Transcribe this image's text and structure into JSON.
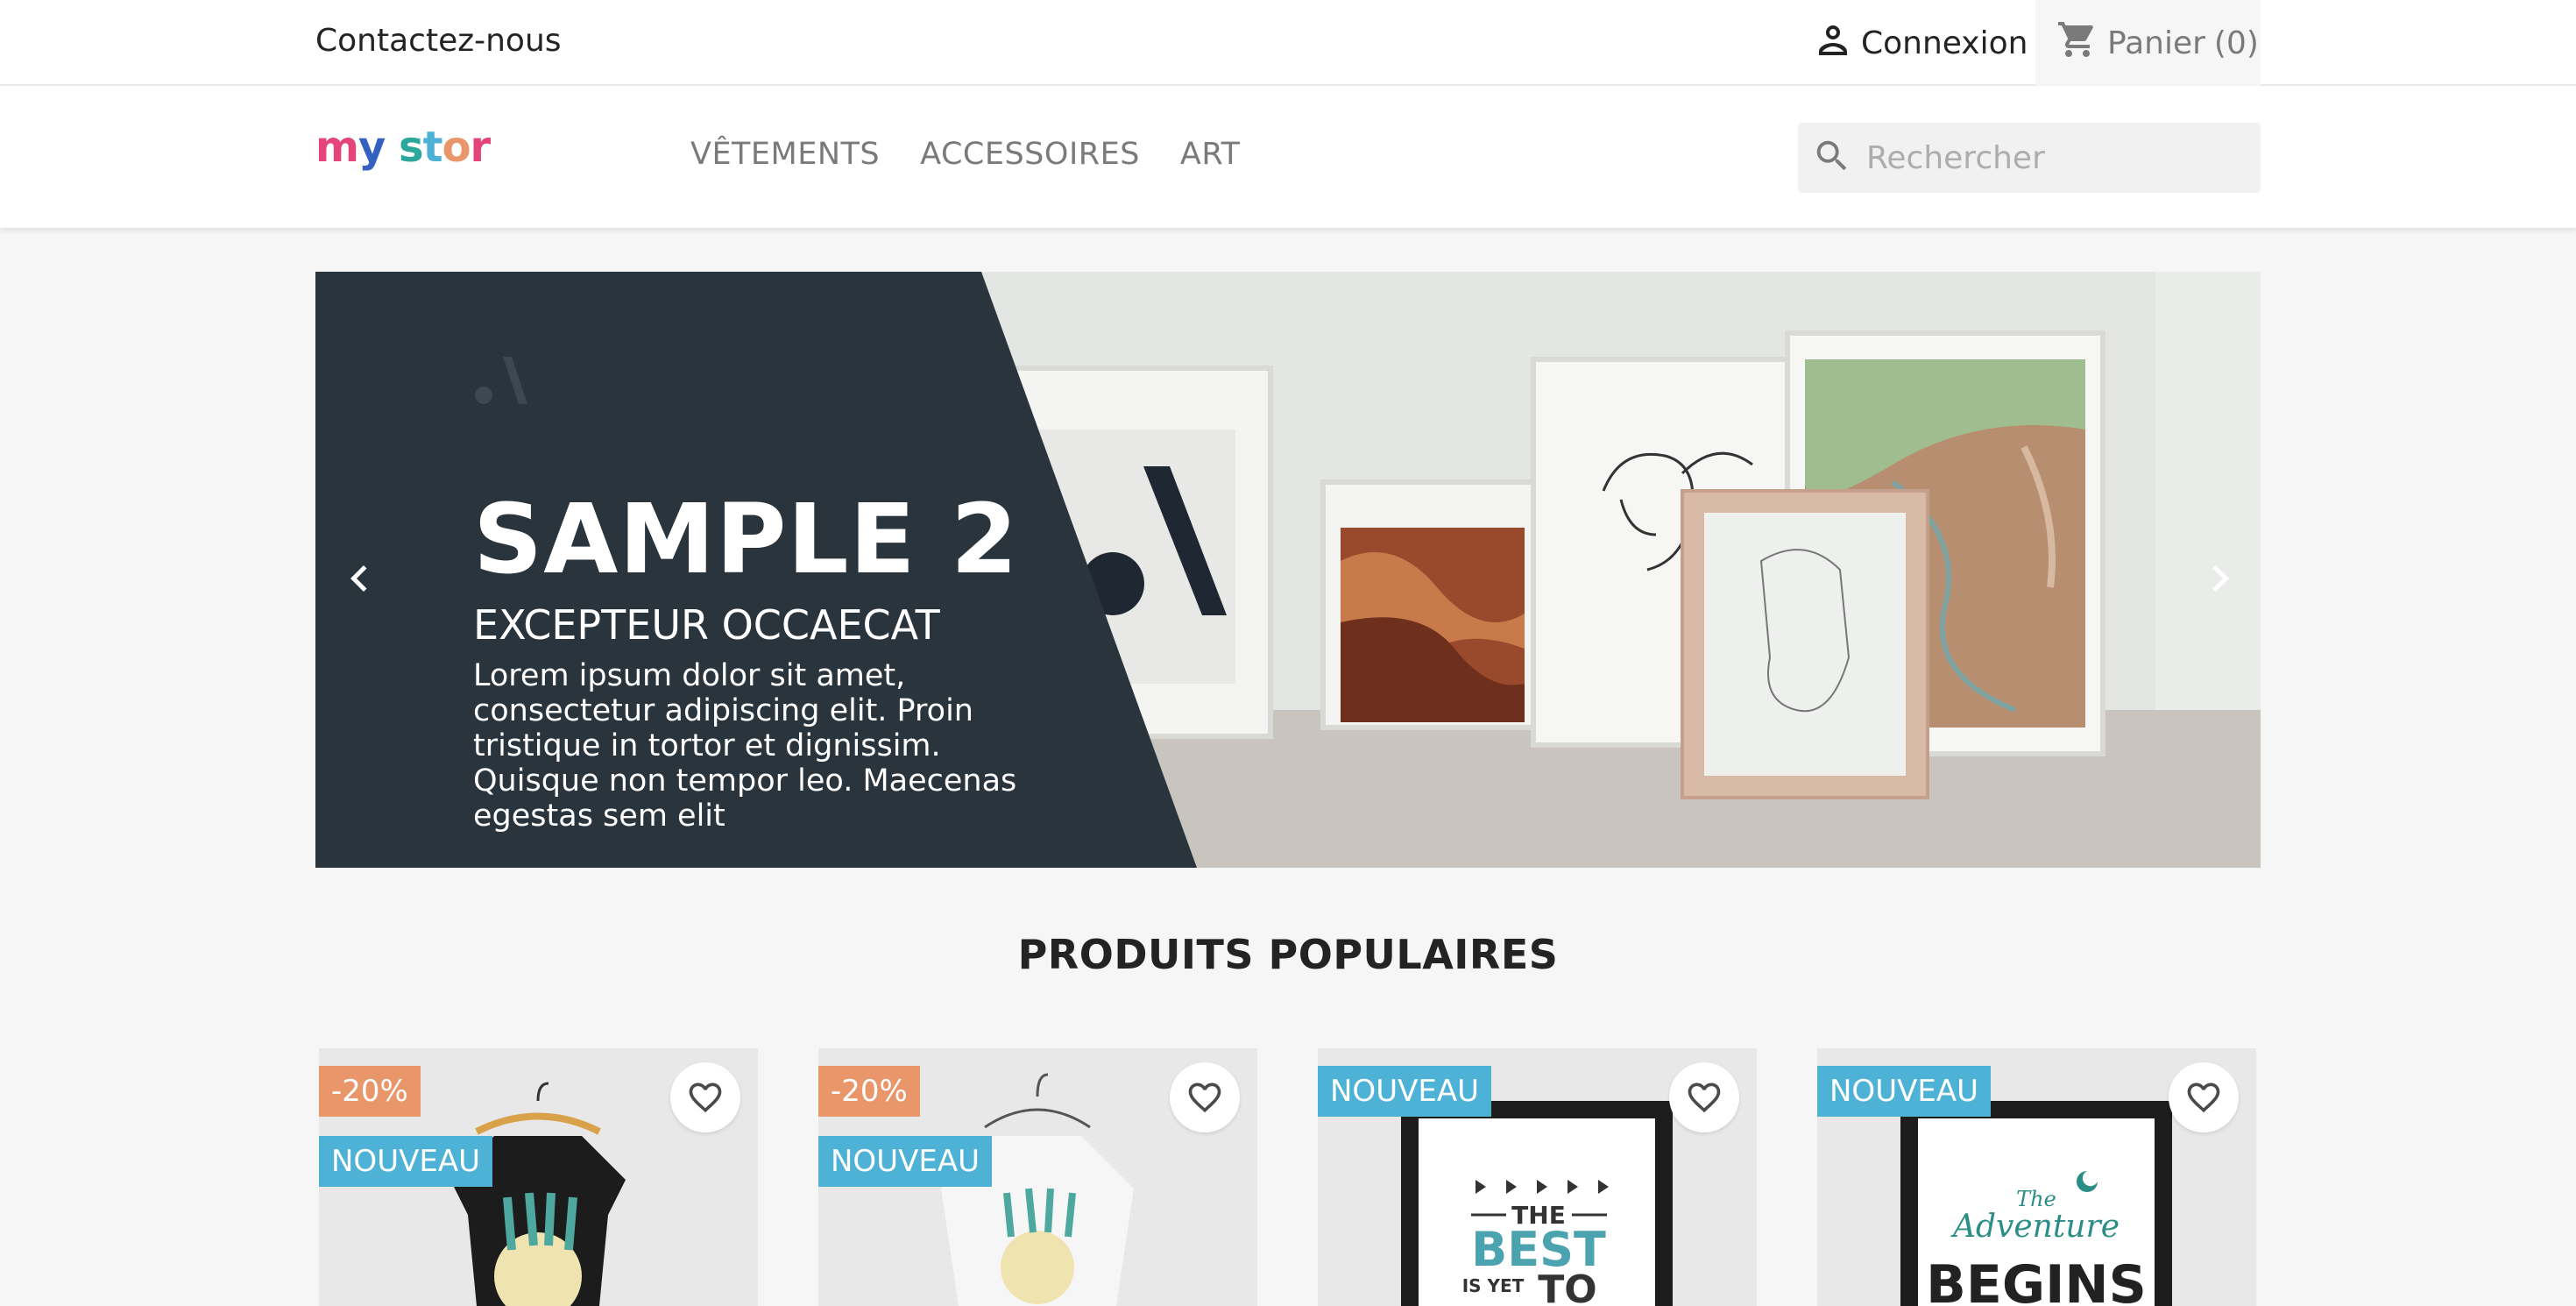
{
  "topbar": {
    "contact_label": "Contactez-nous",
    "signin_label": "Connexion",
    "cart_label": "Panier",
    "cart_count": "(0)"
  },
  "header": {
    "logo_text": "my store",
    "nav": [
      "VÊTEMENTS",
      "ACCESSOIRES",
      "ART"
    ],
    "search_placeholder": "Rechercher"
  },
  "carousel": {
    "title": "SAMPLE 2",
    "subtitle": "EXCEPTEUR OCCAECAT",
    "description": "Lorem ipsum dolor sit amet, consectetur adipiscing elit. Proin tristique in tortor et dignissim. Quisque non tempor leo. Maecenas egestas sem elit"
  },
  "section": {
    "title": "PRODUITS POPULAIRES"
  },
  "products": [
    {
      "discount": "-20%",
      "new": "NOUVEAU",
      "image": "hummingbird-tshirt-black"
    },
    {
      "discount": "-20%",
      "new": "NOUVEAU",
      "image": "hummingbird-sweater-white"
    },
    {
      "new": "NOUVEAU",
      "image": "poster-the-best-is-yet-to-come",
      "poster_lines": [
        "THE",
        "BEST",
        "IS YET",
        "TO"
      ]
    },
    {
      "new": "NOUVEAU",
      "image": "poster-the-adventure-begins",
      "poster_lines": [
        "The",
        "Adventure",
        "BEGINS"
      ]
    }
  ],
  "colors": {
    "accent_blue": "#4eb2d6",
    "discount_orange": "#e8966a",
    "slide_panel": "#29343d"
  }
}
